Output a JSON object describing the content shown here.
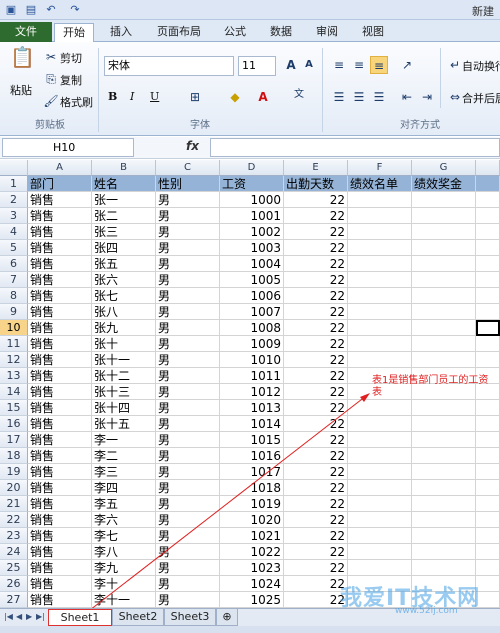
{
  "titlebar": {
    "title": "新建"
  },
  "tabs": {
    "file": "文件",
    "home": "开始",
    "insert": "插入",
    "layout": "页面布局",
    "formulas": "公式",
    "data": "数据",
    "review": "审阅",
    "view": "视图"
  },
  "ribbon": {
    "paste": "粘贴",
    "cut": "剪切",
    "copy": "复制",
    "format_painter": "格式刷",
    "clipboard": "剪贴板",
    "font_name": "宋体",
    "font_size": "11",
    "font_group": "字体",
    "bold": "B",
    "italic": "I",
    "underline": "U",
    "wrap": "自动换行",
    "merge": "合并后居",
    "align_group": "对齐方式"
  },
  "formula": {
    "namebox": "H10",
    "fx": "fx"
  },
  "columns": [
    "A",
    "B",
    "C",
    "D",
    "E",
    "F",
    "G"
  ],
  "headers": [
    "部门",
    "姓名",
    "性别",
    "工资",
    "出勤天数",
    "绩效名单",
    "绩效奖金"
  ],
  "rows": [
    [
      "销售",
      "张一",
      "男",
      "1000",
      "22"
    ],
    [
      "销售",
      "张二",
      "男",
      "1001",
      "22"
    ],
    [
      "销售",
      "张三",
      "男",
      "1002",
      "22"
    ],
    [
      "销售",
      "张四",
      "男",
      "1003",
      "22"
    ],
    [
      "销售",
      "张五",
      "男",
      "1004",
      "22"
    ],
    [
      "销售",
      "张六",
      "男",
      "1005",
      "22"
    ],
    [
      "销售",
      "张七",
      "男",
      "1006",
      "22"
    ],
    [
      "销售",
      "张八",
      "男",
      "1007",
      "22"
    ],
    [
      "销售",
      "张九",
      "男",
      "1008",
      "22"
    ],
    [
      "销售",
      "张十",
      "男",
      "1009",
      "22"
    ],
    [
      "销售",
      "张十一",
      "男",
      "1010",
      "22"
    ],
    [
      "销售",
      "张十二",
      "男",
      "1011",
      "22"
    ],
    [
      "销售",
      "张十三",
      "男",
      "1012",
      "22"
    ],
    [
      "销售",
      "张十四",
      "男",
      "1013",
      "22"
    ],
    [
      "销售",
      "张十五",
      "男",
      "1014",
      "22"
    ],
    [
      "销售",
      "李一",
      "男",
      "1015",
      "22"
    ],
    [
      "销售",
      "李二",
      "男",
      "1016",
      "22"
    ],
    [
      "销售",
      "李三",
      "男",
      "1017",
      "22"
    ],
    [
      "销售",
      "李四",
      "男",
      "1018",
      "22"
    ],
    [
      "销售",
      "李五",
      "男",
      "1019",
      "22"
    ],
    [
      "销售",
      "李六",
      "男",
      "1020",
      "22"
    ],
    [
      "销售",
      "李七",
      "男",
      "1021",
      "22"
    ],
    [
      "销售",
      "李八",
      "男",
      "1022",
      "22"
    ],
    [
      "销售",
      "李九",
      "男",
      "1023",
      "22"
    ],
    [
      "销售",
      "李十",
      "男",
      "1024",
      "22"
    ],
    [
      "销售",
      "李十一",
      "男",
      "1025",
      "22"
    ]
  ],
  "selected_row": "10",
  "sheets": [
    "Sheet1",
    "Sheet2",
    "Sheet3"
  ],
  "annotation": "表1是销售部门员工的工资表",
  "watermark": "我爱IT技术网",
  "watermark_url": "www.52ij.com",
  "colors": {
    "header_fill": "#95b3d7",
    "annotation": "#e02020",
    "file_tab": "#2e6b2e"
  }
}
